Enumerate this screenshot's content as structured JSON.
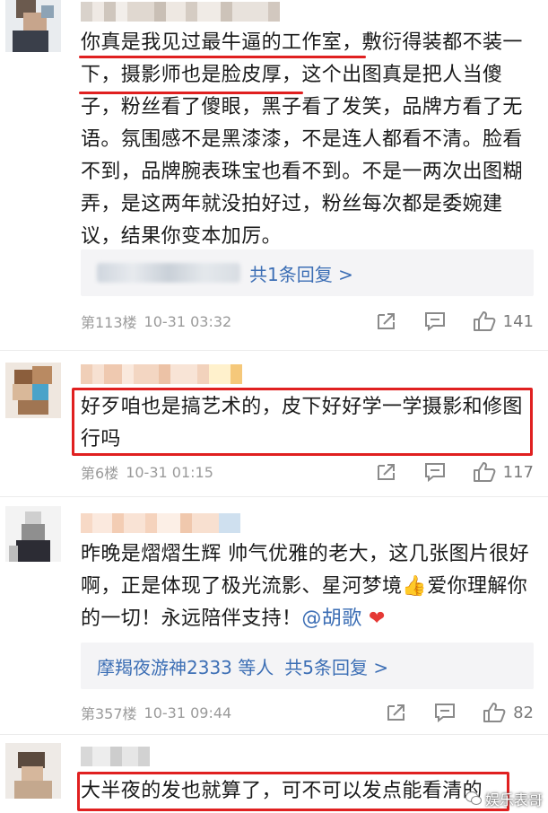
{
  "comments": [
    {
      "text": "你真是我见过最牛逼的工作室，敷衍得装都不装一下，摄影师也是脸皮厚，这个出图真是把人当傻子，粉丝看了傻眼，黑子看了发笑，品牌方看了无语。氛围感不是黑漆漆，不是连人都看不清。脸看不到，品牌腕表珠宝也看不到。不是一两次出图糊弄，是这两年就没拍好过，粉丝每次都是委婉建议，结果你变本加厉。",
      "reply_label": "共1条回复 >",
      "floor": "第113楼",
      "time": "10-31 03:32",
      "likes": "141"
    },
    {
      "text": "好歹咱也是搞艺术的，皮下好好学一学摄影和修图行吗",
      "floor": "第6楼",
      "time": "10-31 01:15",
      "likes": "117"
    },
    {
      "text_a": "昨晚是熠熠生辉 帅气优雅的老大，这几张图片很好啊，正是体现了极光流影、星河梦境",
      "text_b": "爱你理解你的一切！永远陪伴支持！",
      "mention": "@胡歌",
      "reply_name": "摩羯夜游神2333 等人",
      "reply_label": "共5条回复 >",
      "floor": "第357楼",
      "time": "10-31 09:44",
      "likes": "82"
    },
    {
      "text": "大半夜的发也就算了，可不可以发点能看清的"
    }
  ],
  "watermark": "娱乐表哥",
  "colors": {
    "accent": "#e02020",
    "link": "#3d6fb5",
    "meta": "#9a9a9a"
  },
  "icons": [
    "share-icon",
    "comment-icon",
    "like-icon",
    "thumbs-up-emoji",
    "heart-emoji",
    "wechat-icon"
  ]
}
